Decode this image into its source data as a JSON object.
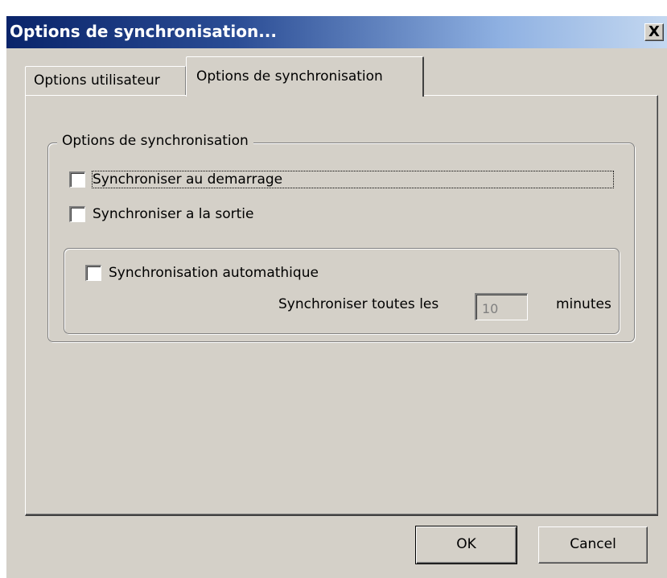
{
  "window": {
    "title": "Options de synchronisation...",
    "close_label": "X"
  },
  "tabs": [
    {
      "label": "Options utilisateur",
      "active": false
    },
    {
      "label": "Options de synchronisation",
      "active": true
    }
  ],
  "sync_group": {
    "legend": "Options de synchronisation",
    "checkboxes": [
      {
        "label": "Synchroniser au demarrage",
        "checked": false
      },
      {
        "label": "Synchroniser a la sortie",
        "checked": false
      }
    ],
    "auto_group": {
      "checkbox": {
        "label": "Synchronisation automathique",
        "checked": false
      },
      "interval_label": "Synchroniser toutes les",
      "interval_value": "10",
      "interval_unit": "minutes"
    }
  },
  "buttons": {
    "ok": "OK",
    "cancel": "Cancel"
  },
  "colors": {
    "dialog_background": "#d4d0c8",
    "titlebar_start": "#0a246a",
    "titlebar_end": "#c4d8f0"
  }
}
